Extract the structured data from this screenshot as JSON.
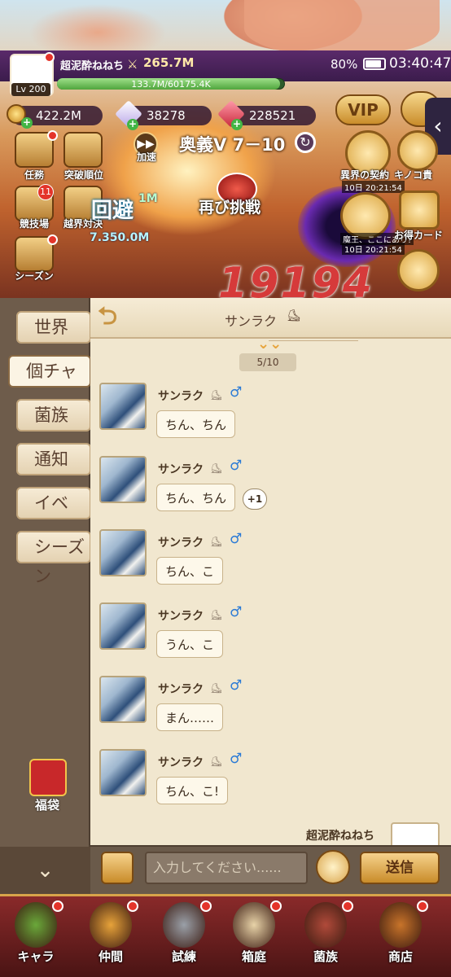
{
  "header": {
    "player_name": "超泥酔ねねち",
    "level": "Lv 200",
    "power": "265.7M",
    "exp_text": "133.7M/60175.4K",
    "exp_fraction": 0.98,
    "battery_pct": "80%",
    "time": "03:40:47"
  },
  "currency": {
    "gold": "422.2M",
    "crystal": "38278",
    "gem": "228521"
  },
  "menu": {
    "mission": "任務",
    "breakthrough": "突破順位",
    "speed": "加速",
    "arena": "競技場",
    "arena_badge": "11",
    "cross_server": "越界対決",
    "season": "シーズン",
    "vip": "VIP"
  },
  "battle": {
    "stage": "奥義Ⅴ 7－10",
    "retry": "再び挑戦",
    "dodge": "回避",
    "damage_small": "7.350.0M",
    "damage_big": "19194",
    "damage_corner": "1M"
  },
  "events": [
    {
      "label": "異界の契約",
      "time": "10日 20:21:54"
    },
    {
      "label": "キノコ貴",
      "time": ""
    },
    {
      "label": "魔王、ここにあり!",
      "time": "10日 20:21:54"
    },
    {
      "label": "お得カード",
      "time": ""
    }
  ],
  "chat_tabs": [
    "世界",
    "個チャ",
    "菌族",
    "通知",
    "イベ",
    "シーズン"
  ],
  "active_tab": "個チャ",
  "lucky_bag": "福袋",
  "chat": {
    "title": "サンラク",
    "page": "5/10",
    "messages": [
      {
        "sender": "サンラク",
        "gender": "♂",
        "text": "ちん、ちん",
        "reaction": ""
      },
      {
        "sender": "サンラク",
        "gender": "♂",
        "text": "ちん、ちん",
        "reaction": "+1"
      },
      {
        "sender": "サンラク",
        "gender": "♂",
        "text": "ちん、こ",
        "reaction": ""
      },
      {
        "sender": "サンラク",
        "gender": "♂",
        "text": "うん、こ",
        "reaction": ""
      },
      {
        "sender": "サンラク",
        "gender": "♂",
        "text": "まん……",
        "reaction": ""
      },
      {
        "sender": "サンラク",
        "gender": "♂",
        "text": "ちん、こ!",
        "reaction": ""
      }
    ],
    "my_name": "超泥酔ねねち",
    "input_placeholder": "入力してください......",
    "send_label": "送信"
  },
  "nav": [
    {
      "label": "キャラ",
      "color": "#6aa83a"
    },
    {
      "label": "仲間",
      "color": "#e7a33a"
    },
    {
      "label": "試練",
      "color": "#9aa0a8"
    },
    {
      "label": "箱庭",
      "color": "#e8d3a8"
    },
    {
      "label": "菌族",
      "color": "#b04a3a"
    },
    {
      "label": "商店",
      "color": "#c8742a"
    }
  ],
  "colors": {
    "accent": "#e7a33a",
    "male": "#2a7ad6",
    "damage": "#d63a3a"
  }
}
